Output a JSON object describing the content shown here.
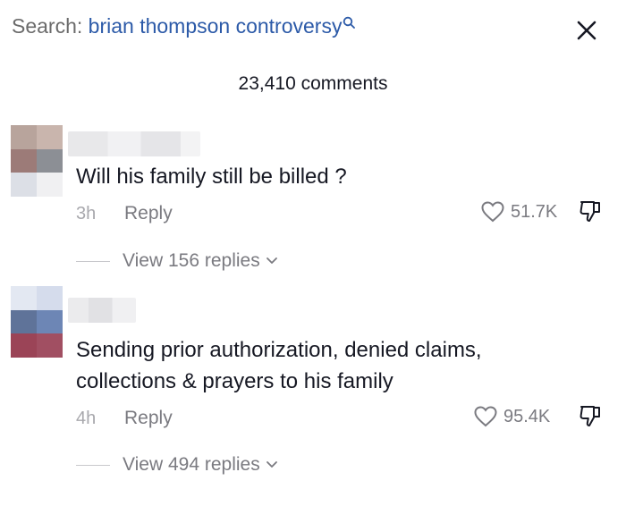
{
  "search": {
    "prefix": "Search:",
    "query": "brian thompson controversy"
  },
  "header": {
    "comment_count": "23,410 comments"
  },
  "comments": [
    {
      "text": "Will his family still be billed ?",
      "time": "3h",
      "reply_label": "Reply",
      "likes": "51.7K",
      "view_replies": "View 156 replies"
    },
    {
      "text": "Sending prior authorization, denied claims, collections & prayers to his family",
      "time": "4h",
      "reply_label": "Reply",
      "likes": "95.4K",
      "view_replies": "View 494 replies"
    }
  ],
  "icons": [
    "search-icon",
    "close-icon",
    "heart-icon",
    "dislike-icon",
    "chevron-down-icon"
  ],
  "colors": {
    "query": "#2c5aa8",
    "muted": "#7a7a80",
    "text": "#161823"
  }
}
